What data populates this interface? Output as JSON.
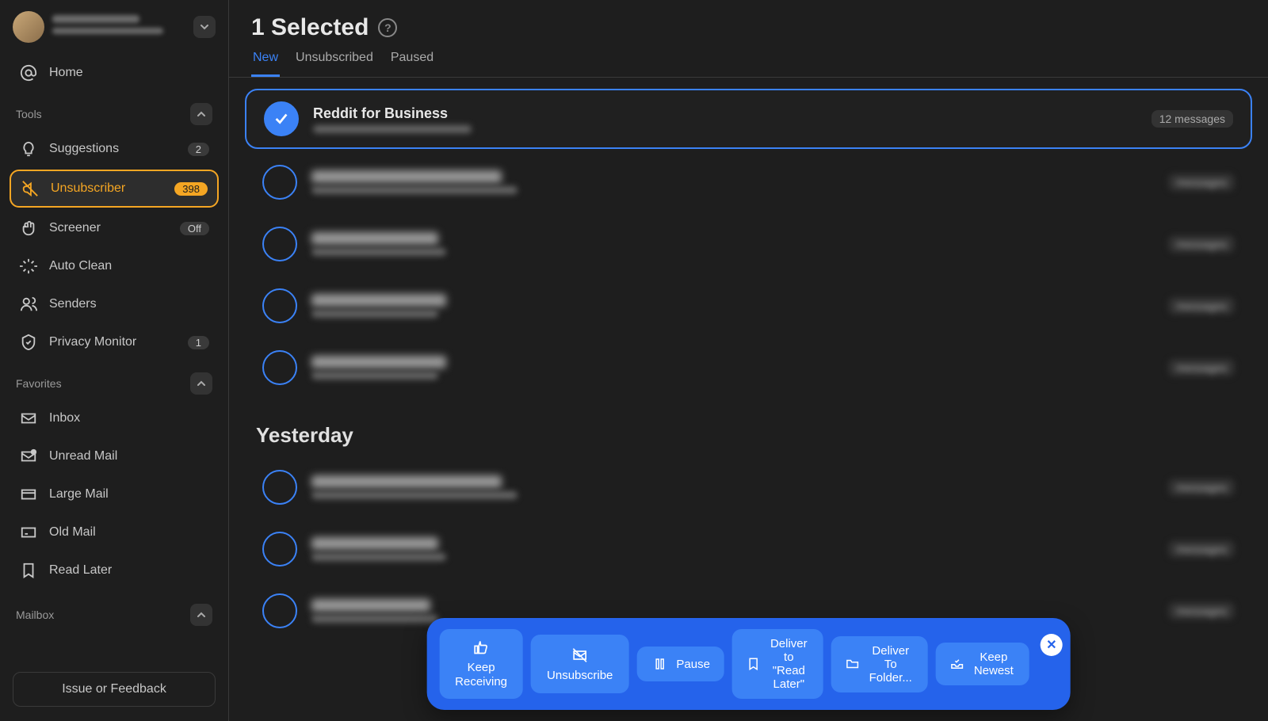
{
  "header": {
    "title": "1 Selected",
    "tabs": [
      {
        "label": "New",
        "active": true
      },
      {
        "label": "Unsubscribed",
        "active": false
      },
      {
        "label": "Paused",
        "active": false
      }
    ]
  },
  "sidebar": {
    "home": "Home",
    "sections": {
      "tools": "Tools",
      "favorites": "Favorites",
      "mailbox": "Mailbox"
    },
    "tools": [
      {
        "label": "Suggestions",
        "badge": "2"
      },
      {
        "label": "Unsubscriber",
        "badge": "398",
        "active": true
      },
      {
        "label": "Screener",
        "badge": "Off"
      },
      {
        "label": "Auto Clean",
        "badge": ""
      },
      {
        "label": "Senders",
        "badge": ""
      },
      {
        "label": "Privacy Monitor",
        "badge": "1"
      }
    ],
    "favorites": [
      {
        "label": "Inbox"
      },
      {
        "label": "Unread Mail"
      },
      {
        "label": "Large Mail"
      },
      {
        "label": "Old Mail"
      },
      {
        "label": "Read Later"
      }
    ],
    "feedback": "Issue or Feedback"
  },
  "list": {
    "selected": {
      "title": "Reddit for Business",
      "meta": "12 messages"
    },
    "divider": "Yesterday",
    "blurred_meta": "messages"
  },
  "actions": {
    "keep_receiving": "Keep Receiving",
    "unsubscribe": "Unsubscribe",
    "pause": "Pause",
    "deliver_read_later": "Deliver to \"Read Later\"",
    "deliver_folder": "Deliver To Folder...",
    "keep_newest": "Keep Newest"
  }
}
